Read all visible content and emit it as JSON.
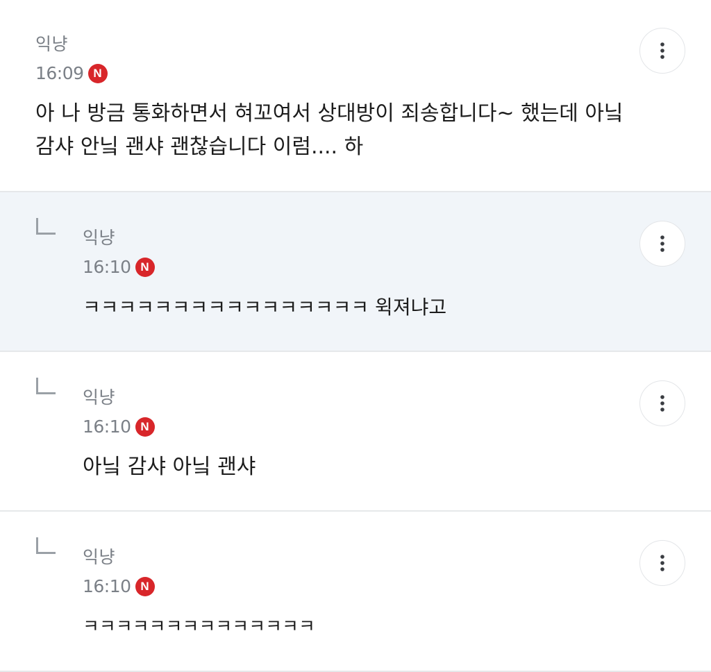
{
  "comments": [
    {
      "author": "익냥",
      "time": "16:09",
      "badge": "N",
      "text_lines": [
        "아 나 방금 통화하면서 혀꼬여서 상대방이 죄송합니다~ 했는데 아닠",
        "감샤 안닠 괜샤 괜찮습니다 이럼.... 하"
      ],
      "is_reply": false
    },
    {
      "author": "익냥",
      "time": "16:10",
      "badge": "N",
      "text": "ㅋㅋㅋㅋㅋㅋㅋㅋㅋㅋㅋㅋㅋㅋㅋㅋ 윅져냐고",
      "is_reply": true,
      "highlighted": true
    },
    {
      "author": "익냥",
      "time": "16:10",
      "badge": "N",
      "text": "아닠 감샤 아닠 괜샤",
      "is_reply": true
    },
    {
      "author": "익냥",
      "time": "16:10",
      "badge": "N",
      "text": "ㅋㅋㅋㅋㅋㅋㅋㅋㅋㅋㅋㅋㅋㅋ",
      "is_reply": true
    }
  ],
  "icons": {
    "more": "more-vertical-icon",
    "reply": "reply-arrow-icon"
  },
  "colors": {
    "badge": "#d8262a",
    "highlight_background": "#f1f5f9",
    "meta_text": "#7b8087"
  }
}
